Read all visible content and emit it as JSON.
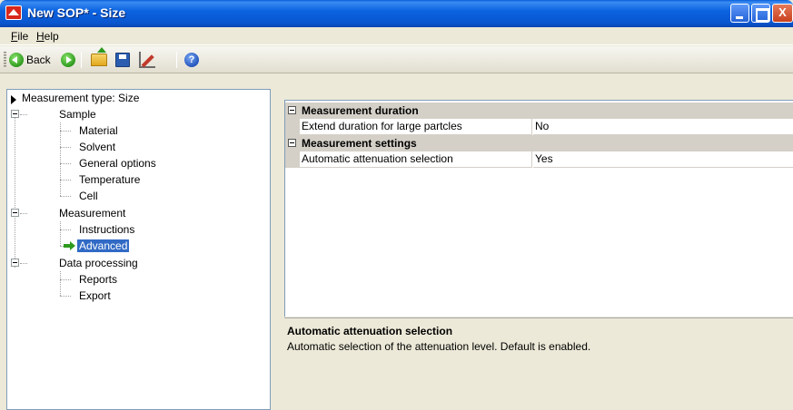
{
  "window": {
    "title": "New SOP* - Size",
    "app_icon": "malvern-icon",
    "buttons": {
      "minimize": "",
      "maximize": "",
      "close": "X"
    }
  },
  "menu": {
    "items": [
      {
        "label": "File"
      },
      {
        "label": "Help"
      }
    ]
  },
  "toolbar": {
    "back_label": "Back",
    "help_symbol": "?"
  },
  "tree": {
    "root": {
      "label": "Measurement type: Size",
      "icon": "right-triangle-icon"
    },
    "groups": [
      {
        "label": "Sample",
        "expanded": true,
        "children": [
          "Material",
          "Solvent",
          "General options",
          "Temperature",
          "Cell"
        ]
      },
      {
        "label": "Measurement",
        "expanded": true,
        "children": [
          "Instructions",
          "Advanced"
        ],
        "selected_child": "Advanced"
      },
      {
        "label": "Data processing",
        "expanded": true,
        "children": [
          "Reports",
          "Export"
        ]
      }
    ]
  },
  "property_grid": {
    "categories": [
      {
        "label": "Measurement duration",
        "properties": [
          {
            "name": "Extend duration for large partcles",
            "value": "No"
          }
        ]
      },
      {
        "label": "Measurement settings",
        "properties": [
          {
            "name": "Automatic attenuation selection",
            "value": "Yes"
          }
        ]
      }
    ]
  },
  "description": {
    "title": "Automatic attenuation selection",
    "text": "Automatic selection of the attenuation level.  Default is enabled."
  },
  "colors": {
    "titlebar": "#0A55CF",
    "selection": "#316AC5",
    "panel": "#ECE9D8",
    "category_row": "#D4D0C8"
  }
}
